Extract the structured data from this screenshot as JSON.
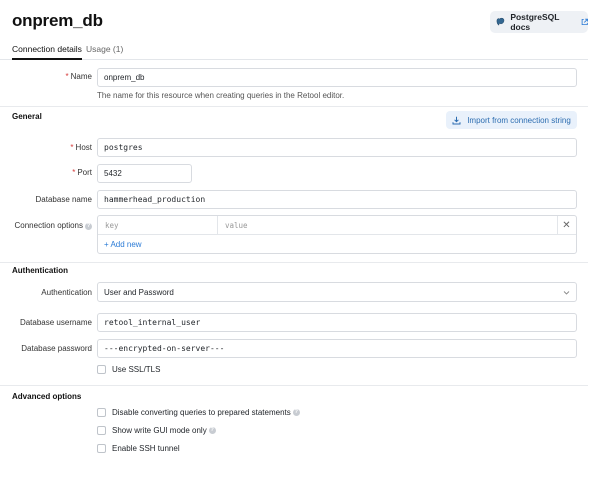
{
  "header": {
    "title": "onprem_db",
    "docs_label": "PostgreSQL docs"
  },
  "tabs": [
    {
      "label": "Connection details",
      "active": true
    },
    {
      "label": "Usage (1)",
      "active": false
    }
  ],
  "form": {
    "required_mark": "*",
    "name": {
      "label": "Name",
      "value": "onprem_db",
      "helper": "The name for this resource when creating queries in the Retool editor."
    },
    "general": {
      "section": "General",
      "import_label": "Import from connection string",
      "host": {
        "label": "Host",
        "value": "postgres"
      },
      "port": {
        "label": "Port",
        "value": "5432"
      },
      "database_name": {
        "label": "Database name",
        "value": "hammerhead_production"
      },
      "connection_options": {
        "label": "Connection options",
        "key_placeholder": "key",
        "value_placeholder": "value",
        "add_label": "+ Add new"
      }
    },
    "authentication": {
      "section": "Authentication",
      "method": {
        "label": "Authentication",
        "value": "User and Password"
      },
      "username": {
        "label": "Database username",
        "value": "retool_internal_user"
      },
      "password": {
        "label": "Database password",
        "value": "---encrypted-on-server---"
      },
      "ssl_label": "Use SSL/TLS"
    },
    "advanced": {
      "section": "Advanced options",
      "options": [
        {
          "label": "Disable converting queries to prepared statements",
          "info": true
        },
        {
          "label": "Show write GUI mode only",
          "info": true
        },
        {
          "label": "Enable SSH tunnel",
          "info": false
        }
      ]
    }
  },
  "colors": {
    "accent": "#2b7bd6",
    "required": "#d63a3a"
  },
  "icons": {
    "docs": "postgresql-icon",
    "external": "external-link-icon",
    "import": "download-icon",
    "remove": "close-icon",
    "info": "info-icon",
    "select": "chevron-down-icon"
  }
}
